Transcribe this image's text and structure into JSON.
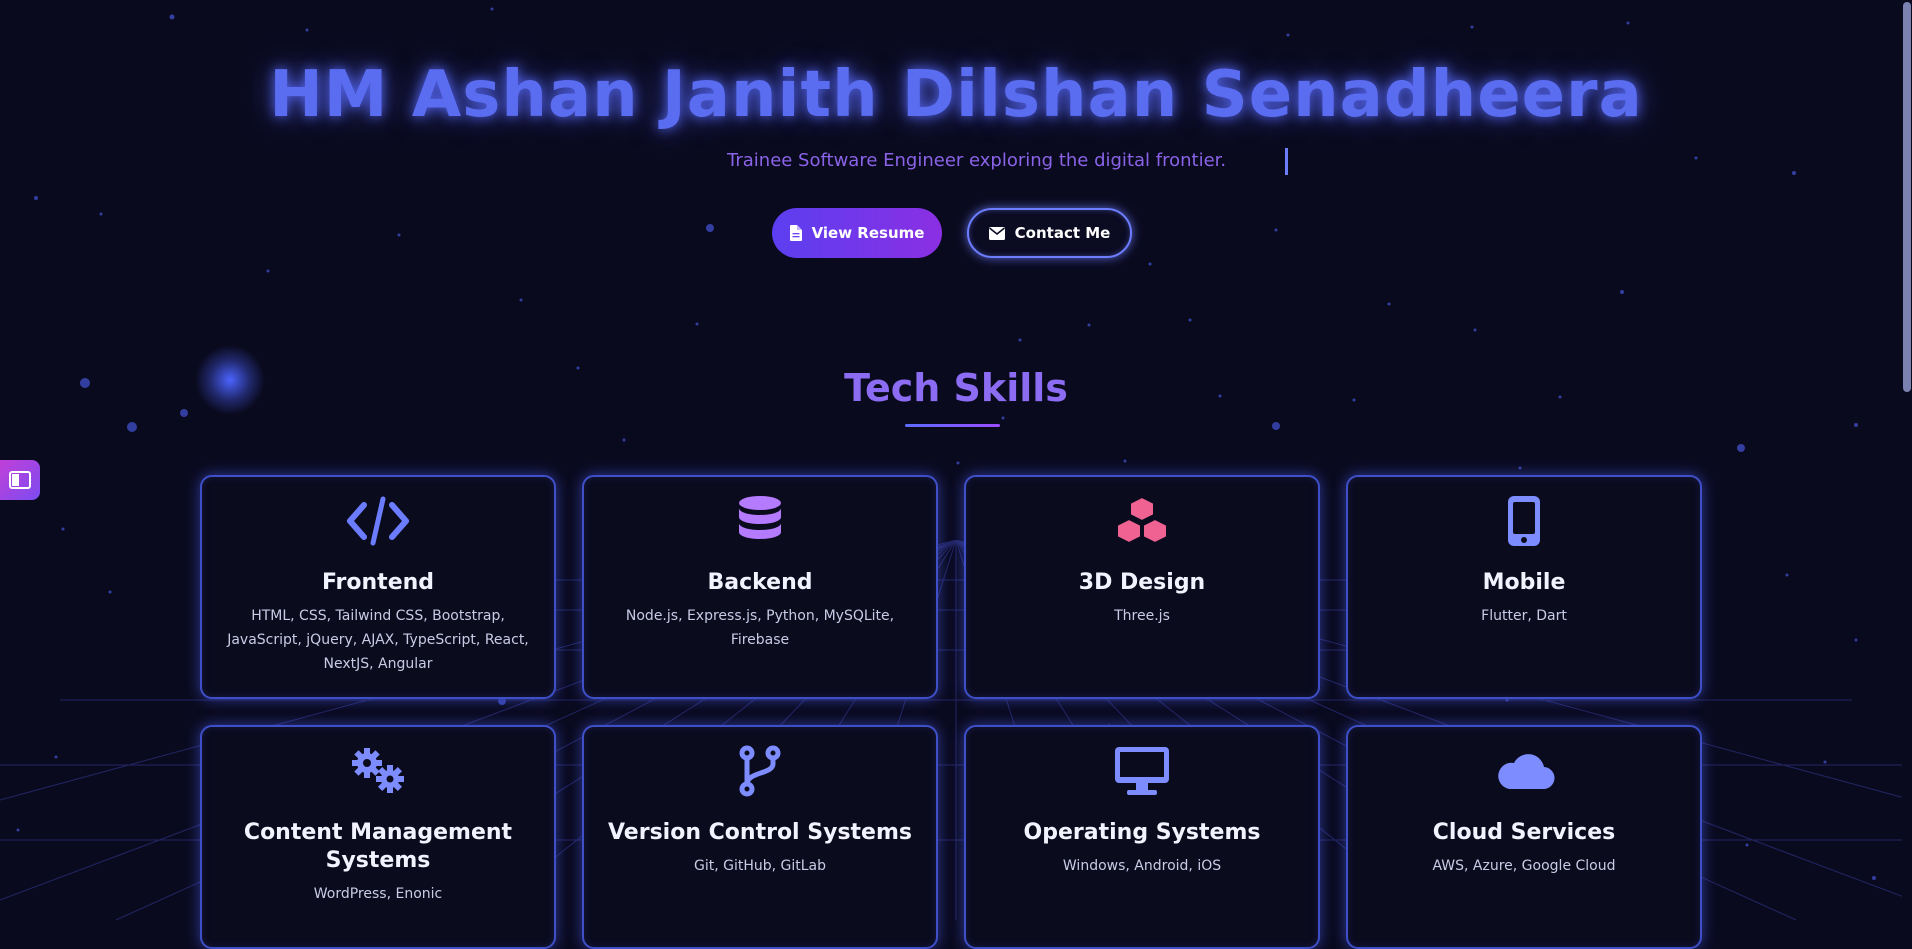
{
  "hero": {
    "title": "HM Ashan Janith Dilshan Senadheera",
    "subtitle": "Trainee Software Engineer exploring the digital frontier."
  },
  "buttons": {
    "resume_label": "View Resume",
    "resume_icon": "file-icon",
    "contact_label": "Contact Me",
    "contact_icon": "envelope-icon"
  },
  "skills": {
    "title": "Tech Skills",
    "cards": [
      {
        "title": "Frontend",
        "icon": "code-icon",
        "text": "HTML, CSS, Tailwind CSS, Bootstrap, JavaScript, jQuery, AJAX, TypeScript, React, NextJS, Angular"
      },
      {
        "title": "Backend",
        "icon": "database-icon",
        "text": "Node.js, Express.js, Python, MySQLite, Firebase"
      },
      {
        "title": "3D Design",
        "icon": "cubes-icon",
        "text": "Three.js"
      },
      {
        "title": "Mobile",
        "icon": "mobile-icon",
        "text": "Flutter, Dart"
      },
      {
        "title": "Content Management Systems",
        "icon": "gears-icon",
        "text": "WordPress, Enonic"
      },
      {
        "title": "Version Control Systems",
        "icon": "code-branch-icon",
        "text": "Git, GitHub, GitLab"
      },
      {
        "title": "Operating Systems",
        "icon": "desktop-icon",
        "text": "Windows, Android, iOS"
      },
      {
        "title": "Cloud Services",
        "icon": "cloud-icon",
        "text": "AWS, Azure, Google Cloud"
      }
    ]
  },
  "colors": {
    "background": "#0a0a1f",
    "accent": "#5a6cf0",
    "purple": "#8c6cf2",
    "pink": "#f06292",
    "card_border": "#3e4fc8"
  }
}
